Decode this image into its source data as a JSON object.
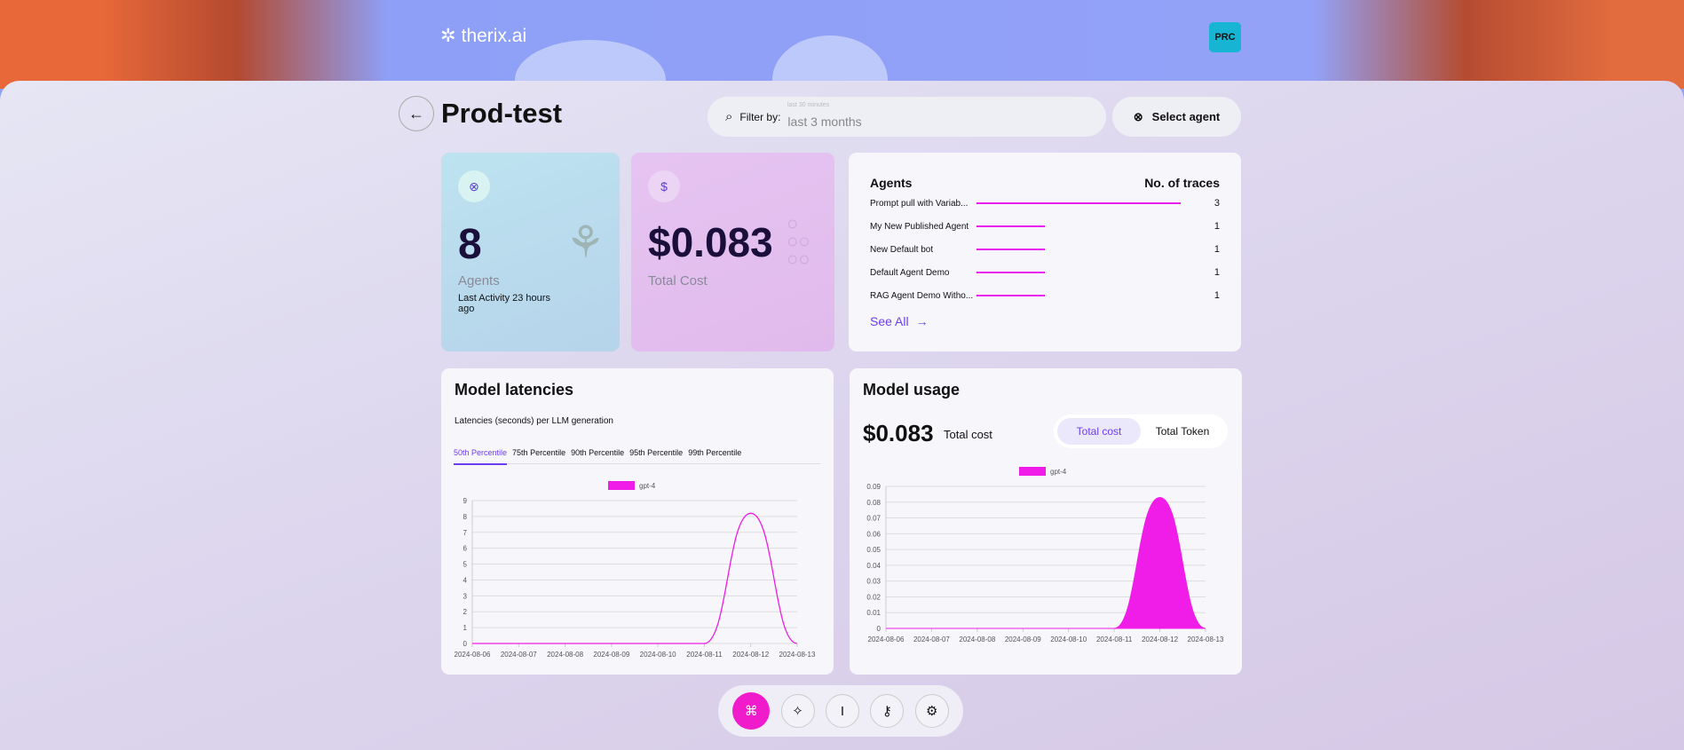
{
  "header": {
    "logo": "therix.ai",
    "avatar": "PRC"
  },
  "page": {
    "title": "Prod-test",
    "back_icon": "arrow-left-icon"
  },
  "filter": {
    "label": "Filter by:",
    "placeholder": "last 30 minutes",
    "value": "last 3 months"
  },
  "select_agent": {
    "label": "Select agent"
  },
  "agents_card": {
    "value": "8",
    "label": "Agents",
    "activity": "Last Activity 23 hours ago"
  },
  "cost_card": {
    "value": "$0.083",
    "label": "Total Cost"
  },
  "traces": {
    "header_agents": "Agents",
    "header_traces": "No. of traces",
    "see_all": "See All",
    "rows": [
      {
        "name": "Prompt pull with Variab...",
        "count": 3
      },
      {
        "name": "My New Published Agent",
        "count": 1
      },
      {
        "name": "New Default bot",
        "count": 1
      },
      {
        "name": "Default Agent Demo",
        "count": 1
      },
      {
        "name": "RAG Agent Demo Witho...",
        "count": 1
      }
    ]
  },
  "latencies": {
    "title": "Model latencies",
    "subtitle": "Latencies (seconds) per LLM generation",
    "tabs": [
      "50th Percentile",
      "75th Percentile",
      "90th Percentile",
      "95th Percentile",
      "99th Percentile"
    ],
    "active_tab": 0
  },
  "usage": {
    "title": "Model usage",
    "total": "$0.083",
    "total_label": "Total cost",
    "toggle": [
      "Total cost",
      "Total Token"
    ],
    "active_toggle": 0
  },
  "colors": {
    "accent": "#6b3ef0",
    "series": "#f01ce8",
    "nav_active": "#f01ccc"
  },
  "chart_data": [
    {
      "type": "line",
      "x": [
        "2024-08-06",
        "2024-08-07",
        "2024-08-08",
        "2024-08-09",
        "2024-08-10",
        "2024-08-11",
        "2024-08-12",
        "2024-08-13"
      ],
      "series": [
        {
          "name": "gpt-4",
          "values": [
            0,
            0,
            0,
            0,
            0,
            0,
            8.2,
            0
          ]
        }
      ],
      "yticks": [
        0,
        1,
        2,
        3,
        4,
        5,
        6,
        7,
        8,
        9
      ],
      "ylim": [
        0,
        9
      ],
      "grid": true,
      "legend": "top"
    },
    {
      "type": "area",
      "x": [
        "2024-08-06",
        "2024-08-07",
        "2024-08-08",
        "2024-08-09",
        "2024-08-10",
        "2024-08-11",
        "2024-08-12",
        "2024-08-13"
      ],
      "series": [
        {
          "name": "gpt-4",
          "values": [
            0,
            0,
            0,
            0,
            0,
            0,
            0.083,
            0
          ]
        }
      ],
      "yticks": [
        "0",
        "0.01",
        "0.02",
        "0.03",
        "0.04",
        "0.05",
        "0.06",
        "0.07",
        "0.08",
        "0.09"
      ],
      "ylim": [
        0,
        0.09
      ],
      "grid": true,
      "legend": "top"
    }
  ],
  "nav": [
    "command-icon",
    "sparkles-icon",
    "text-cursor-icon",
    "key-icon",
    "gear-icon"
  ]
}
